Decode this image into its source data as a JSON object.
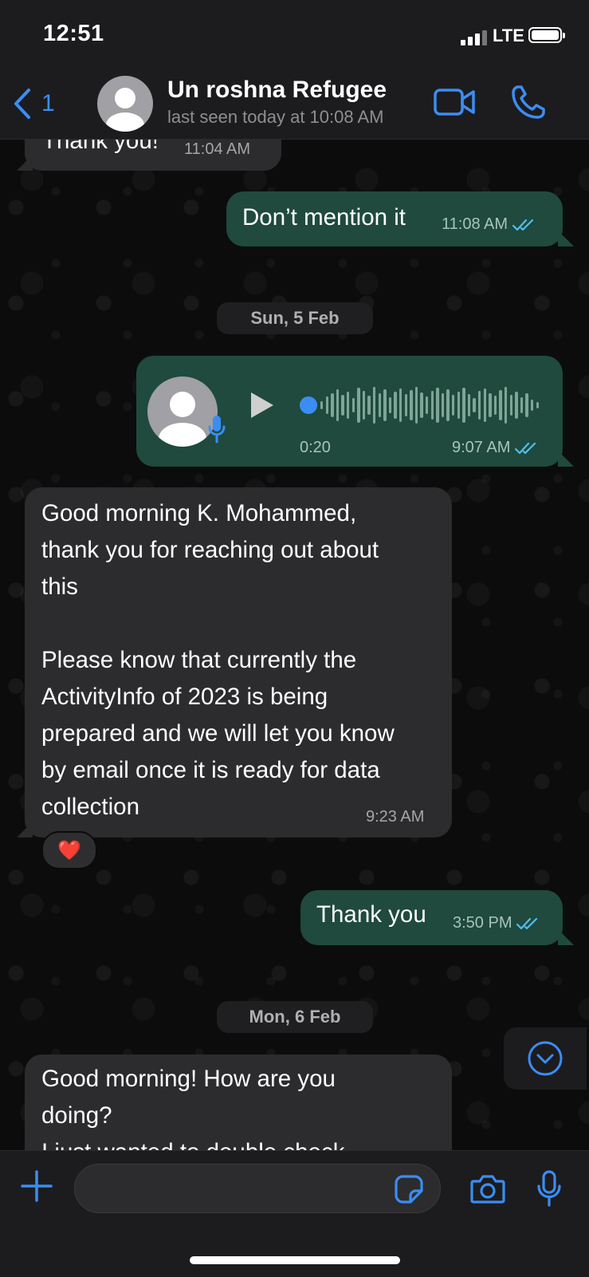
{
  "status_bar": {
    "time": "12:51",
    "network": "LTE"
  },
  "header": {
    "back_count": "1",
    "contact_name": "Un roshna Refugee",
    "last_seen": "last seen today at 10:08 AM"
  },
  "messages": {
    "m1": {
      "text": "Thank you!",
      "time": "11:04 AM"
    },
    "m2": {
      "text": "Don’t mention it",
      "time": "11:08 AM"
    },
    "date1": "Sun, 5 Feb",
    "voice": {
      "duration": "0:20",
      "time": "9:07 AM"
    },
    "m3": {
      "text": "Good morning K. Mohammed,\nthank you for reaching out about\nthis\n\nPlease know that currently the\nActivityInfo of 2023 is being\nprepared and we will let you know\nby email once it is ready for data\ncollection",
      "time": "9:23 AM",
      "reaction": "❤️"
    },
    "m4": {
      "text": "Thank you",
      "time": "3:50 PM"
    },
    "date2": "Mon, 6 Feb",
    "m5": {
      "text": "Good morning! How are you\ndoing?\nI just wanted to double check"
    }
  },
  "composer": {
    "placeholder": ""
  },
  "colors": {
    "accent": "#3b8df3",
    "outgoing_bubble": "#1f4a3d",
    "incoming_bubble": "#2c2c2e",
    "read_ticks": "#53bdeb"
  }
}
